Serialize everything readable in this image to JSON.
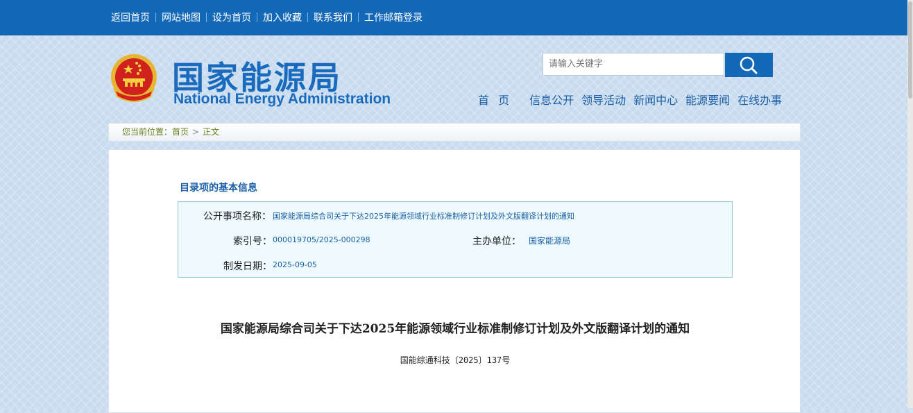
{
  "top_links": [
    "返回首页",
    "网站地图",
    "设为首页",
    "加入收藏",
    "联系我们",
    "工作邮箱登录"
  ],
  "logo": {
    "cn": "国家能源局",
    "en": "National Energy Administration"
  },
  "search": {
    "placeholder": "请输入关键字"
  },
  "main_nav": [
    "首 页",
    "信息公开",
    "领导活动",
    "新闻中心",
    "能源要闻",
    "在线办事"
  ],
  "breadcrumb": {
    "prefix": "您当前位置：",
    "home": "首页",
    "arrow": ">",
    "current": "正文"
  },
  "catalog": {
    "section_title": "目录项的基本信息",
    "item_label": "公开事项名称：",
    "item_value": "国家能源局综合司关于下达2025年能源领域行业标准制修订计划及外文版翻译计划的通知",
    "index_label": "索引号：",
    "index_value": "000019705/2025-000298",
    "org_label": "主办单位：",
    "org_value": "国家能源局",
    "date_label": "制发日期：",
    "date_value": "2025-09-05"
  },
  "document": {
    "title": "国家能源局综合司关于下达2025年能源领域行业标准制修订计划及外文版翻译计划的通知",
    "number": "国能综通科技〔2025〕137号"
  },
  "colors": {
    "brand_blue": "#1468b8",
    "logo_blue": "#1a6bbd",
    "info_bg": "#eefafd"
  }
}
